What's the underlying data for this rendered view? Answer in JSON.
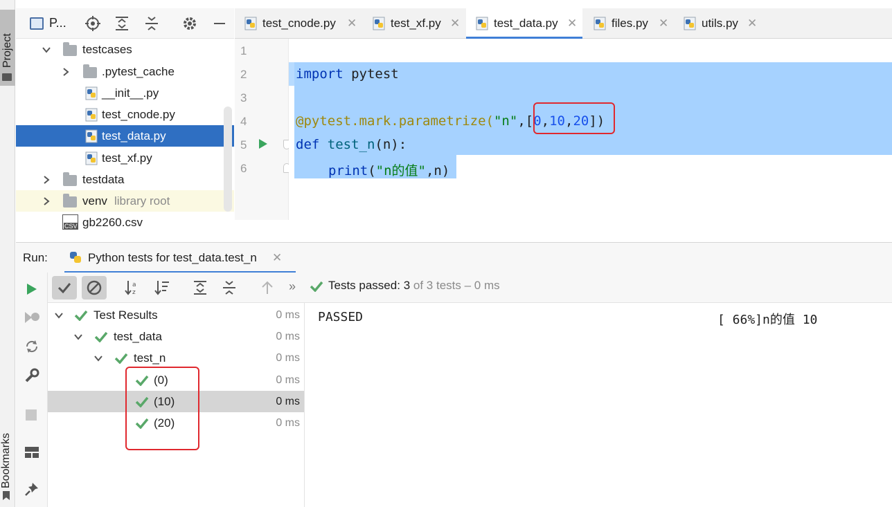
{
  "sidebar": {
    "project_tab": "Project",
    "bookmarks_tab": "Bookmarks"
  },
  "project_panel": {
    "title": "P...",
    "tree": [
      {
        "label": "testcases",
        "type": "folder",
        "expanded": true
      },
      {
        "label": ".pytest_cache",
        "type": "folder",
        "expanded": false
      },
      {
        "label": "__init__.py",
        "type": "python-file"
      },
      {
        "label": "test_cnode.py",
        "type": "python-file"
      },
      {
        "label": "test_data.py",
        "type": "python-file",
        "selected": true
      },
      {
        "label": "test_xf.py",
        "type": "python-file"
      },
      {
        "label": "testdata",
        "type": "folder",
        "expanded": false
      },
      {
        "label": "venv",
        "type": "folder",
        "expanded": false,
        "suffix": "library root"
      },
      {
        "label": "gb2260.csv",
        "type": "csv-file"
      }
    ]
  },
  "editor": {
    "tabs": [
      {
        "label": "test_cnode.py",
        "active": false
      },
      {
        "label": "test_xf.py",
        "active": false
      },
      {
        "label": "test_data.py",
        "active": true
      },
      {
        "label": "files.py",
        "active": false
      },
      {
        "label": "utils.py",
        "active": false
      }
    ],
    "line_numbers": [
      "1",
      "2",
      "3",
      "4",
      "5",
      "6"
    ],
    "code": {
      "l2_kw": "import",
      "l2_rest": " pytest",
      "l4_dec": "@pytest.mark.parametrize(",
      "l4_str": "\"n\"",
      "l4_comma": ",[",
      "l4_n0": "0",
      "l4_c1": ",",
      "l4_n1": "10",
      "l4_c2": ",",
      "l4_n2": "20",
      "l4_end": "])",
      "l5_kw": "def",
      "l5_fn": " test_n",
      "l5_rest": "(n):",
      "l6_fn": "print",
      "l6_open": "(",
      "l6_str": "\"n的值\"",
      "l6_rest": ",n)"
    }
  },
  "run": {
    "label": "Run:",
    "tab_title": "Python tests for test_data.test_n",
    "status_prefix": "Tests passed:",
    "status_count": "3",
    "status_suffix": "of 3 tests – 0 ms",
    "results": [
      {
        "label": "Test Results",
        "time": "0 ms",
        "level": 0
      },
      {
        "label": "test_data",
        "time": "0 ms",
        "level": 1
      },
      {
        "label": "test_n",
        "time": "0 ms",
        "level": 2
      },
      {
        "label": "(0)",
        "time": "0 ms",
        "level": 3
      },
      {
        "label": "(10)",
        "time": "0 ms",
        "level": 3,
        "selected": true
      },
      {
        "label": "(20)",
        "time": "0 ms",
        "level": 3
      }
    ],
    "console_status": "PASSED",
    "console_output": "[ 66%]n的值 10"
  },
  "colors": {
    "selection_blue": "#2f6fc2",
    "code_highlight": "#a6d2ff",
    "pass_green": "#59a869",
    "annotation_red": "#e0282e"
  }
}
